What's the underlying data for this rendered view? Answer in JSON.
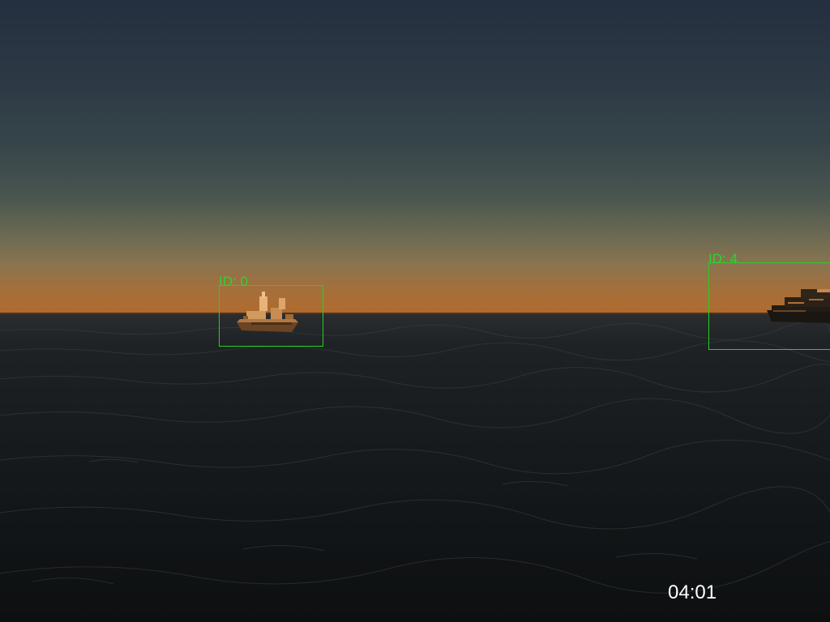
{
  "scene": {
    "sky_top_color": "#242f3f",
    "sky_horizon_color": "#b16a2c",
    "sea_color": "#15191b",
    "box_color": "#22d322"
  },
  "detections": [
    {
      "label": "ID: 0",
      "object": "ship"
    },
    {
      "label": "ID: 4",
      "object": "ship"
    }
  ],
  "overlay": {
    "timer": "04:01"
  }
}
